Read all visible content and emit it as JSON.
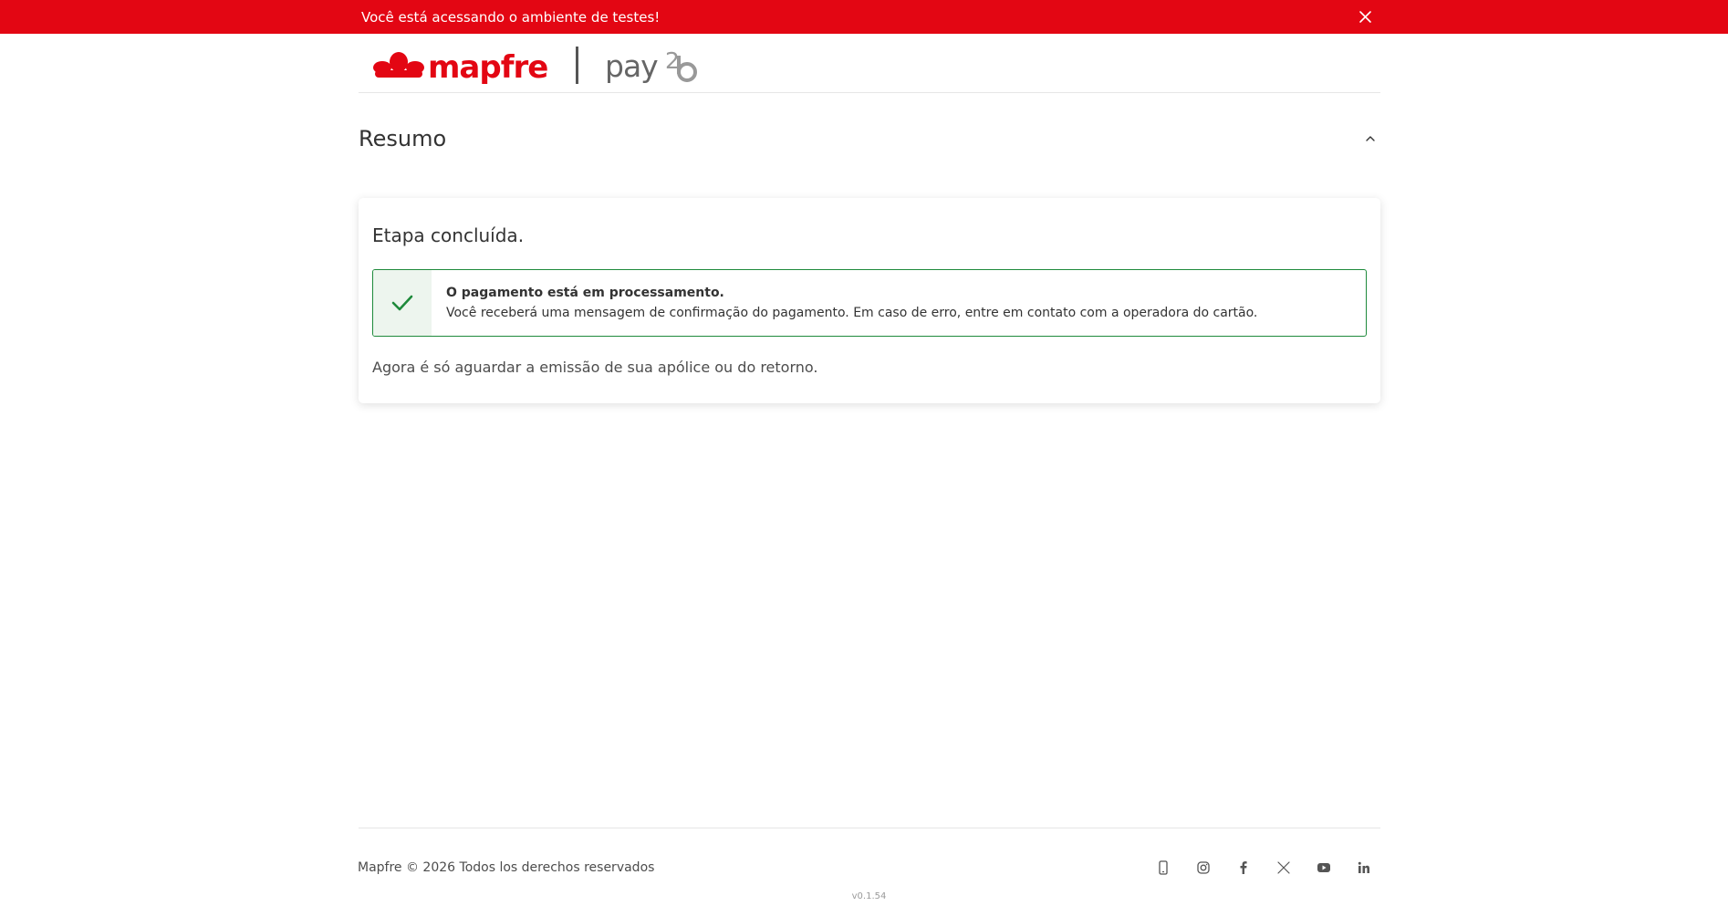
{
  "banner": {
    "message": "Você está acessando o ambiente de testes!",
    "color": "#e30613",
    "close_icon": "close-icon"
  },
  "header": {
    "brand": "mapfre",
    "product": "pay2b",
    "brand_color": "#e30613",
    "product_color": "#666666"
  },
  "summary": {
    "title": "Resumo",
    "collapse_icon": "chevron-up-icon"
  },
  "step_card": {
    "title": "Etapa concluída.",
    "alert": {
      "title": "O pagamento está em processamento.",
      "message": "Você receberá uma mensagem de confirmação do pagamento. Em caso de erro, entre em contato com a operadora do cartão.",
      "icon": "check-icon",
      "color": "#1e8a3b"
    },
    "footer_text": "Agora é só aguardar a emissão de sua apólice ou do retorno."
  },
  "footer": {
    "copyright": "Mapfre © 2026 Todos los derechos reservados",
    "version": "v0.1.54",
    "social": [
      "phone-icon",
      "instagram-icon",
      "facebook-icon",
      "x-icon",
      "youtube-icon",
      "linkedin-icon"
    ]
  }
}
